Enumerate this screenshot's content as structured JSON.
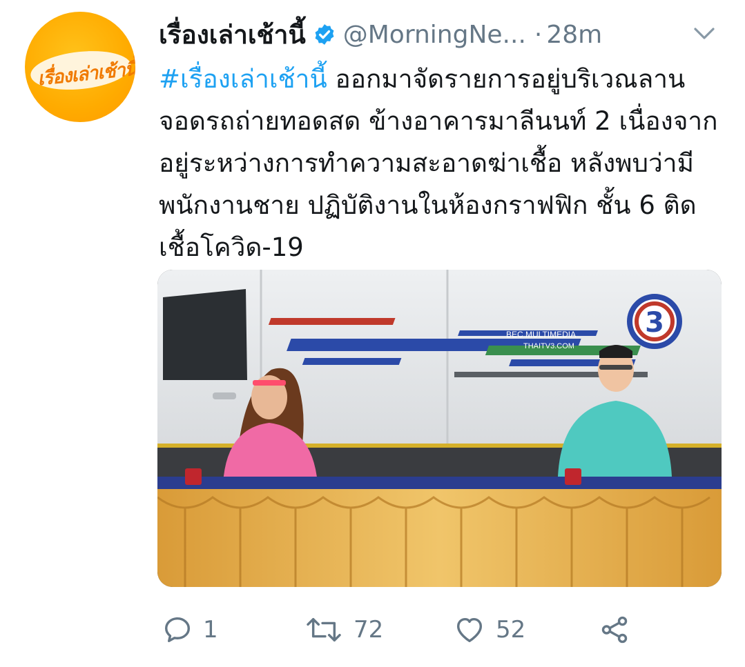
{
  "account": {
    "avatar_logo_text": "เรื่องเล่าเช้านี้",
    "display_name": "เรื่องเล่าเช้านี้",
    "handle": "@MorningNe...",
    "separator": "·",
    "time": "28m",
    "verified_icon": "verified-badge-icon",
    "menu_icon": "chevron-down-icon"
  },
  "tweet": {
    "hashtag": "#เรื่องเล่าเช้านี้",
    "body": " ออกมาจัดรายการอยู่บริเวณลานจอดรถถ่ายทอดสด ข้างอาคารมาลีนนท์ 2 เนื่องจากอยู่ระหว่างการทำความสะอาดฆ่าเชื้อ หลังพบว่ามีพนักงานชาย ปฏิบัติงานในห้องกราฟฟิก ชั้น 6 ติดเชื้อโควิด-19"
  },
  "media": {
    "van_brand": "BEC MULTIMEDIA",
    "van_url": "THAITV3.COM",
    "channel_number": "3"
  },
  "actions": {
    "reply": {
      "icon": "reply-icon",
      "count": "1"
    },
    "retweet": {
      "icon": "retweet-icon",
      "count": "72"
    },
    "like": {
      "icon": "heart-icon",
      "count": "52"
    },
    "share": {
      "icon": "share-icon"
    }
  },
  "colors": {
    "link": "#1da1f2",
    "muted": "#657786",
    "avatar": "#ffab00"
  }
}
